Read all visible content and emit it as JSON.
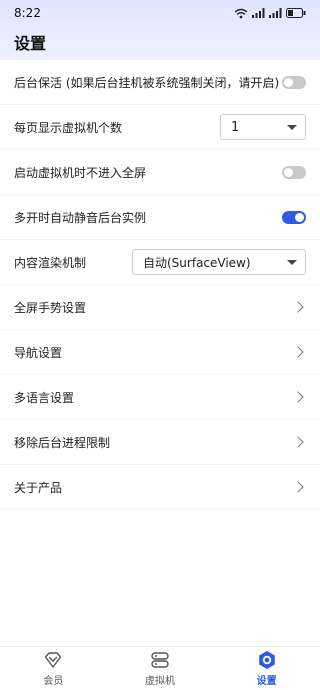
{
  "status_bar": {
    "time": "8:22",
    "icons": [
      "wifi-icon",
      "signal-icon",
      "signal-icon",
      "battery-icon"
    ]
  },
  "header": {
    "title": "设置"
  },
  "settings": [
    {
      "label": "后台保活 (如果后台挂机被系统强制关闭，请开启)",
      "control": "toggle",
      "on": false
    },
    {
      "label": "每页显示虚拟机个数",
      "control": "select",
      "value": "1"
    },
    {
      "label": "启动虚拟机时不进入全屏",
      "control": "toggle",
      "on": false
    },
    {
      "label": "多开时自动静音后台实例",
      "control": "toggle",
      "on": true
    },
    {
      "label": "内容渲染机制",
      "control": "select",
      "value": "自动(SurfaceView)"
    },
    {
      "label": "全屏手势设置",
      "control": "chevron"
    },
    {
      "label": "导航设置",
      "control": "chevron"
    },
    {
      "label": "多语言设置",
      "control": "chevron"
    },
    {
      "label": "移除后台进程限制",
      "control": "chevron"
    },
    {
      "label": "关于产品",
      "control": "chevron"
    }
  ],
  "bottom_nav": [
    {
      "label": "会员",
      "icon": "diamond-icon",
      "active": false
    },
    {
      "label": "虚拟机",
      "icon": "server-icon",
      "active": false
    },
    {
      "label": "设置",
      "icon": "gear-icon",
      "active": true
    }
  ],
  "colors": {
    "accent": "#2d5be3",
    "toggle_off": "#c9c9c9",
    "header_bg": "#e4e9ff"
  }
}
